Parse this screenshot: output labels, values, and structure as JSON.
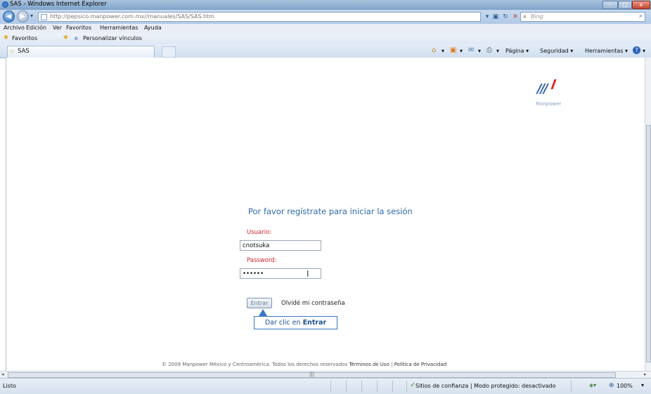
{
  "window": {
    "title": "SAS - Windows Internet Explorer",
    "btn_min": "–",
    "btn_max": "□",
    "btn_close": "x"
  },
  "address": {
    "url": "http://pepsico.manpower.com.mx//manuales/SAS/SAS.htm",
    "search_placeholder": "Bing"
  },
  "menu": [
    "Archivo",
    "Edición",
    "Ver",
    "Favoritos",
    "Herramientas",
    "Ayuda"
  ],
  "favorites": {
    "favorites_label": "Favoritos",
    "personalize_label": "Personalizar vínculos"
  },
  "tab": {
    "label": "SAS"
  },
  "command_bar": {
    "page": "Página ▾",
    "safety": "Seguridad ▾",
    "tools": "Herramientas ▾"
  },
  "logo": {
    "word": "Manpower"
  },
  "login": {
    "heading": "Por favor regístrate para iniciar la sesión",
    "user_label": "Usuario:",
    "user_value": "cnotsuka",
    "password_label": "Password:",
    "password_value": "••••••",
    "enter_button": "Entrar",
    "forgot_link": "Olvidé mi contraseña"
  },
  "callout": {
    "text_prefix": "Dar clic en ",
    "text_bold": "Entrar"
  },
  "footer": {
    "copyright": "© 2009 Manpower México y Centroamérica. Todos los derechos reservados",
    "terms": "Términos de Uso",
    "separator": "|",
    "privacy": "Política de Privacidad"
  },
  "status": {
    "left": "Listo",
    "security": "Sitios de confianza | Modo protegido: desactivado",
    "zoom": "100%"
  }
}
